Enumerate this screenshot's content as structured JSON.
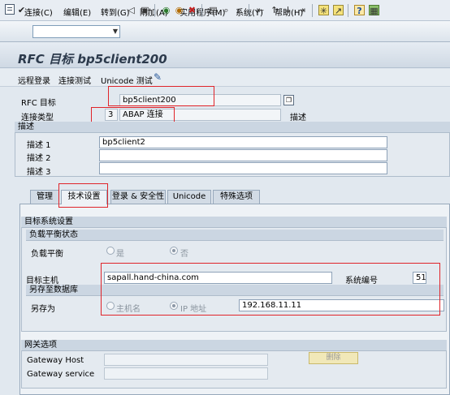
{
  "menu": {
    "items": [
      "连接(C)",
      "编辑(E)",
      "转到(G)",
      "附加(A)",
      "实用程序(M)",
      "系统(Y)",
      "帮助(H)"
    ]
  },
  "toolbar": {
    "command_value": "",
    "icons": [
      "enter-icon",
      "save-icon",
      "back-icon",
      "exit-icon",
      "cancel-icon",
      "print-icon",
      "find-icon",
      "find-next-icon",
      "first-page-icon",
      "prev-page-icon",
      "next-page-icon",
      "last-page-icon",
      "create-session-icon",
      "shortcut-icon",
      "help-icon",
      "layout-icon"
    ]
  },
  "title": "RFC 目标 bp5client200",
  "app_toolbar": {
    "remote_logon": "远程登录",
    "connection_test": "连接测试",
    "unicode_test": "Unicode 测试"
  },
  "header": {
    "rfc_dest_label": "RFC 目标",
    "rfc_dest_value": "bp5client200",
    "conn_type_label": "连接类型",
    "conn_type_code": "3",
    "conn_type_value": "ABAP 连接",
    "desc_label": "描述"
  },
  "description": {
    "group_title": "描述",
    "desc1_label": "描述 1",
    "desc1_value": "bp5client2",
    "desc2_label": "描述 2",
    "desc2_value": "",
    "desc3_label": "描述 3",
    "desc3_value": ""
  },
  "tabs": [
    "管理",
    "技术设置",
    "登录 & 安全性",
    "Unicode",
    "特殊选项"
  ],
  "active_tab": "技术设置",
  "target_system": {
    "group_title": "目标系统设置",
    "load_balance_title": "负载平衡状态",
    "load_balance_label": "负载平衡",
    "yes_label": "是",
    "no_label": "否",
    "target_host_label": "目标主机",
    "target_host_value": "sapall.hand-china.com",
    "system_number_label": "系统编号",
    "system_number_value": "51",
    "save_to_db_title": "另存至数据库",
    "save_as_label": "另存为",
    "hostname_label": "主机名",
    "ip_label": "IP 地址",
    "ip_value": "192.168.11.11"
  },
  "gateway": {
    "group_title": "网关选项",
    "host_label": "Gateway Host",
    "host_value": "",
    "service_label": "Gateway service",
    "service_value": "",
    "delete_label": "删除"
  },
  "colors": {
    "highlight": "#e0242a",
    "title_text": "#2c3a4c"
  }
}
